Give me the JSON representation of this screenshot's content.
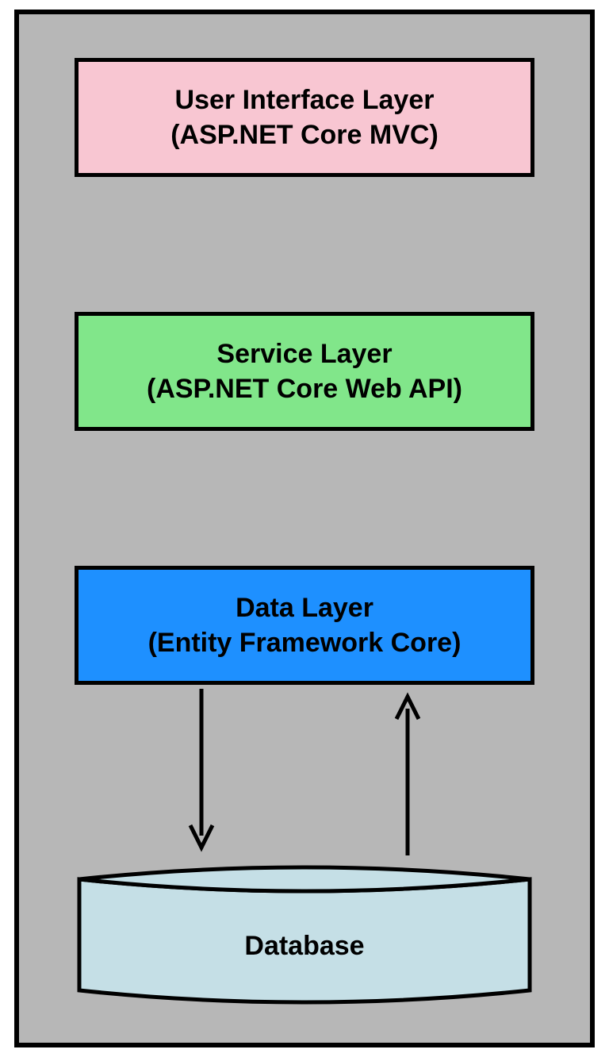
{
  "layers": {
    "ui": {
      "title": "User Interface Layer",
      "subtitle": "(ASP.NET Core MVC)"
    },
    "service": {
      "title": "Service Layer",
      "subtitle": "(ASP.NET Core Web API)"
    },
    "data": {
      "title": "Data Layer",
      "subtitle": "(Entity Framework Core)"
    }
  },
  "database": {
    "label": "Database"
  },
  "colors": {
    "ui": "#f8c6d2",
    "service": "#81e68a",
    "data": "#1e90ff",
    "db": "#c5dfe6",
    "border": "#000000",
    "bg": "#b7b7b7"
  }
}
